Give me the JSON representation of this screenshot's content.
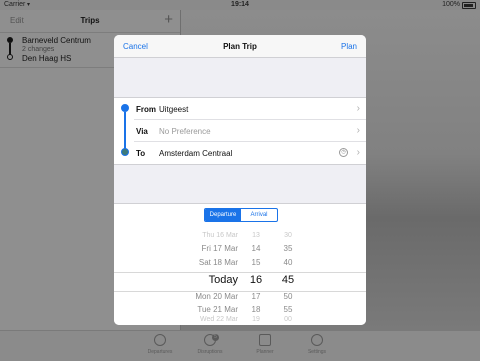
{
  "status_bar": {
    "carrier": "Carrier",
    "time": "19:14",
    "battery": "100%"
  },
  "sidebar": {
    "edit_label": "Edit",
    "title": "Trips",
    "add_label": "+",
    "trips": [
      {
        "from": "Barneveld Centrum",
        "changes": "2 changes",
        "to": "Den Haag HS"
      }
    ]
  },
  "modal": {
    "cancel_label": "Cancel",
    "title": "Plan Trip",
    "plan_label": "Plan",
    "from_label": "From",
    "from_value": "Uitgeest",
    "via_label": "Via",
    "via_placeholder": "No Preference",
    "to_label": "To",
    "to_value": "Amsterdam Centraal",
    "segment": {
      "departure": "Departure",
      "arrival": "Arrival",
      "selected": "Departure"
    },
    "picker": {
      "rows": [
        {
          "date": "Thu 16 Mar",
          "hour": "13",
          "minute": "30"
        },
        {
          "date": "Fri 17 Mar",
          "hour": "14",
          "minute": "35"
        },
        {
          "date": "Sat 18 Mar",
          "hour": "15",
          "minute": "40"
        },
        {
          "date": "Today",
          "hour": "16",
          "minute": "45"
        },
        {
          "date": "Mon 20 Mar",
          "hour": "17",
          "minute": "50"
        },
        {
          "date": "Tue 21 Mar",
          "hour": "18",
          "minute": "55"
        },
        {
          "date": "Wed 22 Mar",
          "hour": "19",
          "minute": "00"
        }
      ]
    }
  },
  "tabbar": {
    "tabs": [
      {
        "label": "Departures"
      },
      {
        "label": "Disruptions",
        "badge": "5"
      },
      {
        "label": "Planner"
      },
      {
        "label": "Settings"
      }
    ]
  },
  "colors": {
    "accent": "#1a73e8"
  }
}
